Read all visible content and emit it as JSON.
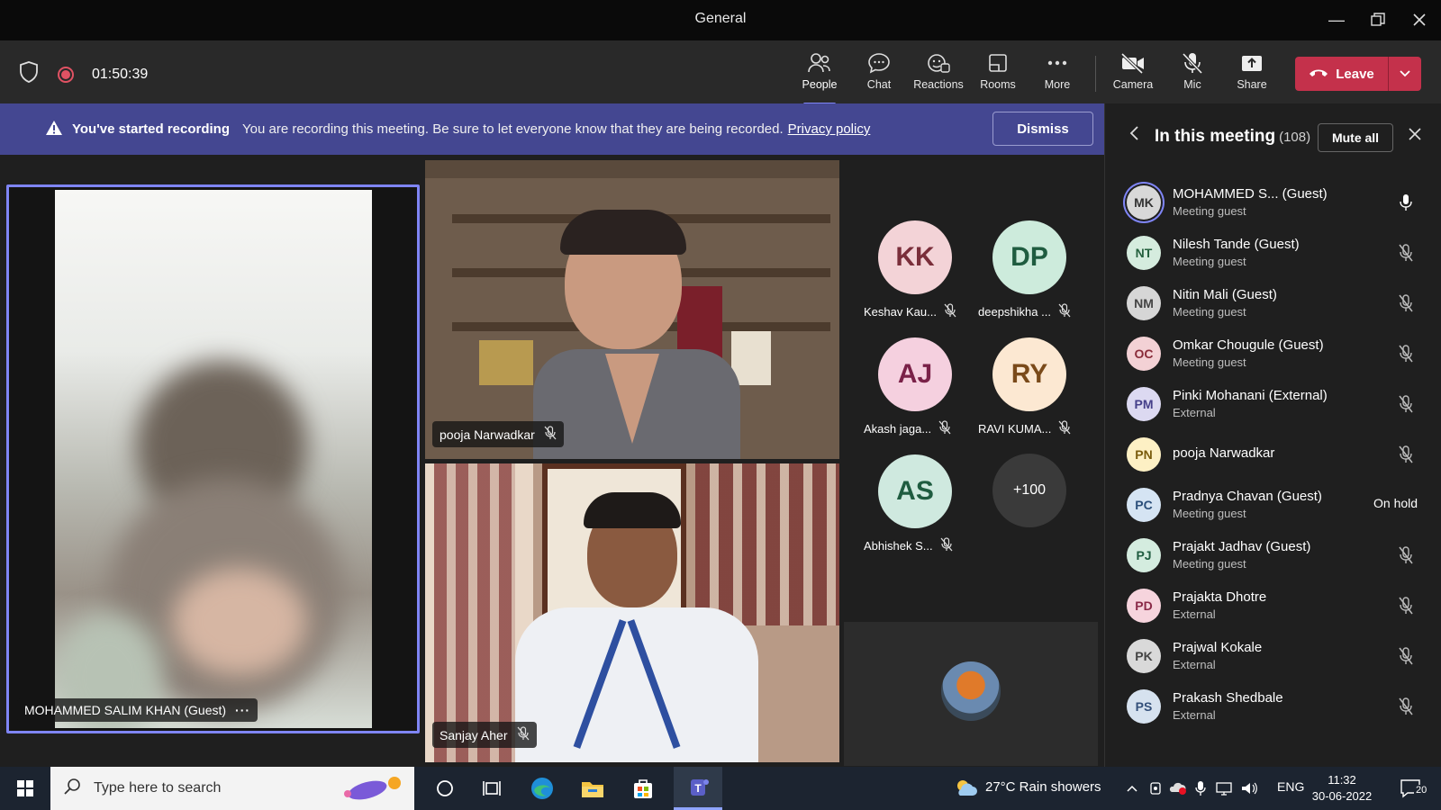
{
  "window": {
    "title": "General"
  },
  "toolbar": {
    "timer": "01:50:39",
    "buttons": {
      "people": "People",
      "chat": "Chat",
      "reactions": "Reactions",
      "rooms": "Rooms",
      "more": "More",
      "camera": "Camera",
      "mic": "Mic",
      "share": "Share"
    },
    "leave_label": "Leave",
    "active_tab": "people"
  },
  "banner": {
    "title": "You've started recording",
    "message": "You are recording this meeting. Be sure to let everyone know that they are being recorded.",
    "link": "Privacy policy",
    "dismiss_label": "Dismiss"
  },
  "stage": {
    "main_speaker": "MOHAMMED SALIM KHAN (Guest)",
    "video_tiles": [
      {
        "name": "pooja Narwadkar"
      },
      {
        "name": "Sanjay Aher"
      }
    ],
    "avatar_tiles": [
      {
        "initials": "KK",
        "name": "Keshav Kau...",
        "color": "#f3d3d7",
        "text_color": "#7a2e3a"
      },
      {
        "initials": "DP",
        "name": "deepshikha ...",
        "color": "#cdebdc",
        "text_color": "#1f5c40"
      },
      {
        "initials": "AJ",
        "name": "Akash jaga...",
        "color": "#f5d0df",
        "text_color": "#7a2148"
      },
      {
        "initials": "RY",
        "name": "RAVI KUMA...",
        "color": "#fce8d2",
        "text_color": "#7a4a1a"
      },
      {
        "initials": "AS",
        "name": "Abhishek S...",
        "color": "#cfe9df",
        "text_color": "#1f5c40"
      }
    ],
    "overflow_count": "+100"
  },
  "panel": {
    "title": "In this meeting",
    "count": "(108)",
    "mute_all_label": "Mute all",
    "participants": [
      {
        "initials": "MK",
        "name": "MOHAMMED S...  (Guest)",
        "sub": "Meeting guest",
        "av_bg": "#d8d8d8",
        "av_fg": "#333333",
        "status": "mic-on",
        "selected": true
      },
      {
        "initials": "NT",
        "name": "Nilesh Tande (Guest)",
        "sub": "Meeting guest",
        "av_bg": "#d5ecde",
        "av_fg": "#25613f",
        "status": "mic-off"
      },
      {
        "initials": "NM",
        "name": "Nitin Mali (Guest)",
        "sub": "Meeting guest",
        "av_bg": "#d6d6d6",
        "av_fg": "#444444",
        "status": "mic-off"
      },
      {
        "initials": "OC",
        "name": "Omkar Chougule (Guest)",
        "sub": "Meeting guest",
        "av_bg": "#f3d1d5",
        "av_fg": "#8a2c3a",
        "status": "mic-off"
      },
      {
        "initials": "PM",
        "name": "Pinki Mohanani (External)",
        "sub": "External",
        "av_bg": "#dcd9f1",
        "av_fg": "#46408a",
        "status": "mic-off"
      },
      {
        "initials": "PN",
        "name": "pooja Narwadkar",
        "sub": "",
        "av_bg": "#fdf0c4",
        "av_fg": "#7a5c0d",
        "status": "mic-off"
      },
      {
        "initials": "PC",
        "name": "Pradnya Chavan (Guest)",
        "sub": "Meeting guest",
        "av_bg": "#d5e4f3",
        "av_fg": "#2b4f7a",
        "status": "hold",
        "hold_label": "On hold"
      },
      {
        "initials": "PJ",
        "name": "Prajakt Jadhav (Guest)",
        "sub": "Meeting guest",
        "av_bg": "#d4ecdf",
        "av_fg": "#1f5c40",
        "status": "mic-off"
      },
      {
        "initials": "PD",
        "name": "Prajakta Dhotre",
        "sub": "External",
        "av_bg": "#f6d4dd",
        "av_fg": "#8a2a48",
        "status": "mic-off"
      },
      {
        "initials": "PK",
        "name": "Prajwal Kokale",
        "sub": "External",
        "av_bg": "#d9d9d9",
        "av_fg": "#444444",
        "status": "mic-off"
      },
      {
        "initials": "PS",
        "name": "Prakash Shedbale",
        "sub": "External",
        "av_bg": "#d6e2ef",
        "av_fg": "#34507a",
        "status": "mic-off"
      }
    ]
  },
  "taskbar": {
    "search_placeholder": "Type here to search",
    "weather": "27°C  Rain showers",
    "lang": "ENG",
    "time": "11:32",
    "date": "30-06-2022",
    "notifications": "20"
  },
  "colors": {
    "accent": "#7f85f5",
    "leave": "#c4314b",
    "banner": "#444791"
  }
}
